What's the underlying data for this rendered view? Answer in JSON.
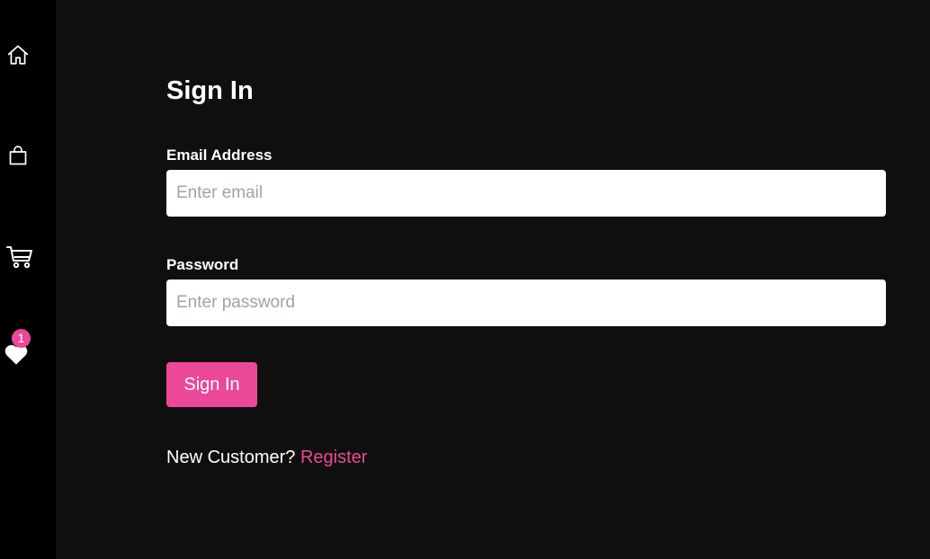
{
  "sidebar": {
    "items": [
      {
        "icon": "home-icon"
      },
      {
        "icon": "shopping-bag-icon"
      },
      {
        "icon": "cart-icon"
      },
      {
        "icon": "heart-icon",
        "badge": "1"
      }
    ]
  },
  "form": {
    "title": "Sign In",
    "email_label": "Email Address",
    "email_placeholder": "Enter email",
    "email_value": "",
    "password_label": "Password",
    "password_placeholder": "Enter password",
    "password_value": "",
    "submit_label": "Sign In",
    "register_prompt": "New Customer?",
    "register_link": "Register"
  },
  "colors": {
    "accent": "#ec4899",
    "sidebar_bg": "#000000",
    "main_bg": "#0f0f0f",
    "text": "#ffffff"
  }
}
